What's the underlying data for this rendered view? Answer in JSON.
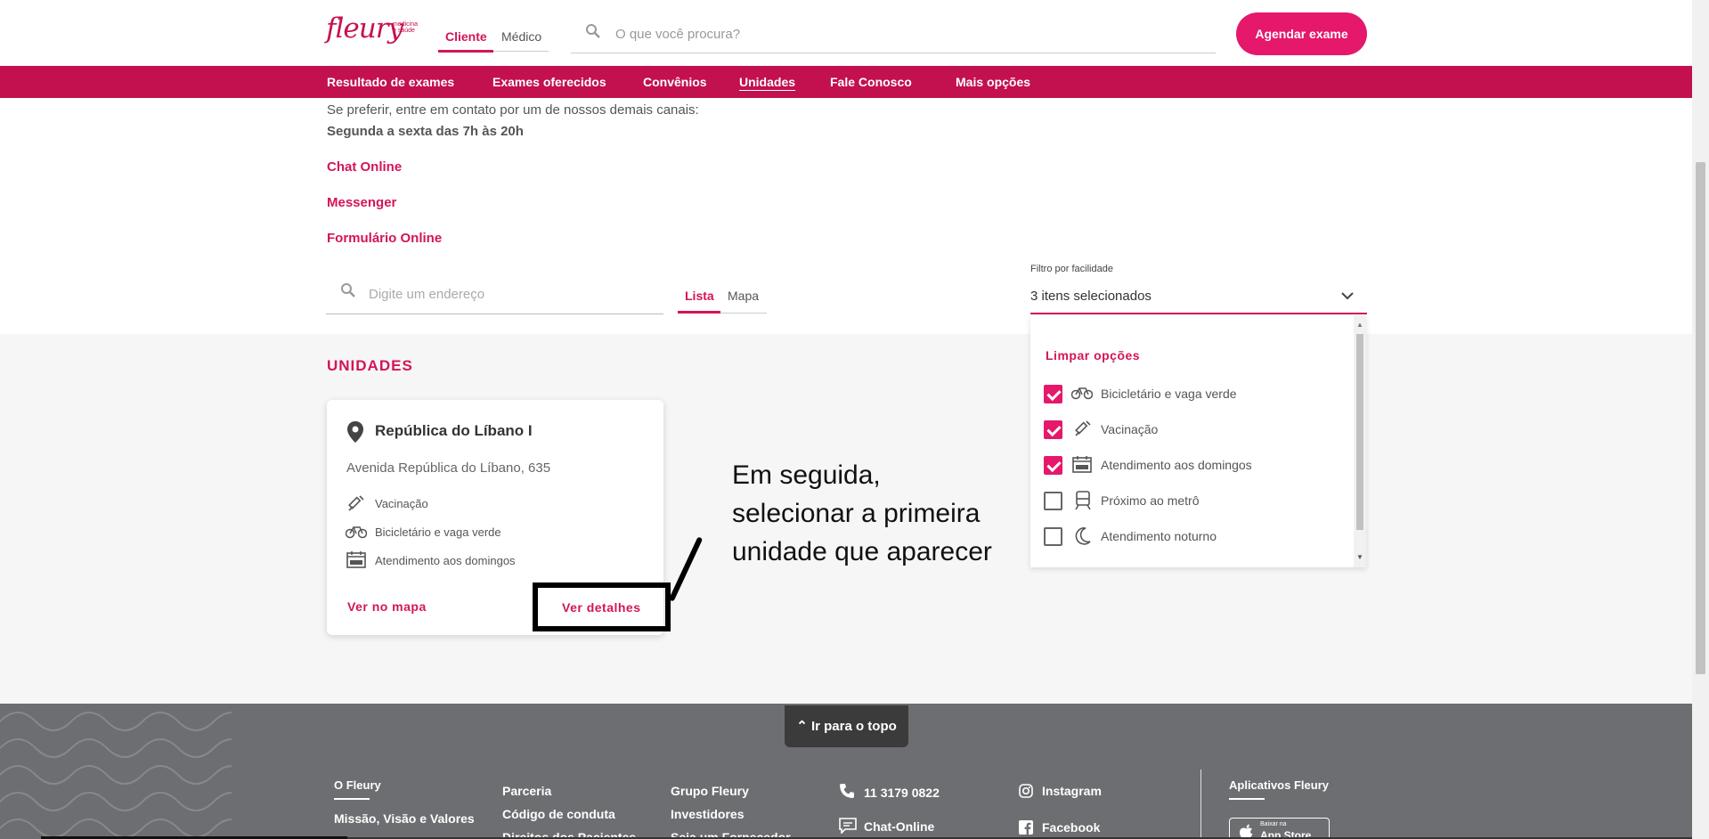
{
  "header": {
    "logo": "fleury",
    "logo_sub_1": "medicina",
    "logo_sub_2": "e saúde",
    "tabs": [
      "Cliente",
      "Médico"
    ],
    "search_placeholder": "O que você procura?",
    "cta": "Agendar exame"
  },
  "nav": [
    "Resultado de exames",
    "Exames oferecidos",
    "Convênios",
    "Unidades",
    "Fale Conosco",
    "Mais opções"
  ],
  "contact": {
    "intro": "Se preferir, entre em contato por um de nossos demais canais:",
    "hours": "Segunda a sexta das 7h às 20h",
    "links": [
      "Chat Online",
      "Messenger",
      "Formulário Online"
    ]
  },
  "search": {
    "address_placeholder": "Digite um endereço",
    "views": [
      "Lista",
      "Mapa"
    ]
  },
  "filter": {
    "label": "Filtro por facilidade",
    "value": "3 itens selecionados",
    "clear": "Limpar opções",
    "options": [
      {
        "label": "Bicicletário e vaga verde",
        "checked": true,
        "icon": "bicycle-icon"
      },
      {
        "label": "Vacinação",
        "checked": true,
        "icon": "syringe-icon"
      },
      {
        "label": "Atendimento aos domingos",
        "checked": true,
        "icon": "calendar-icon"
      },
      {
        "label": "Próximo ao metrô",
        "checked": false,
        "icon": "train-icon"
      },
      {
        "label": "Atendimento noturno",
        "checked": false,
        "icon": "moon-icon"
      }
    ]
  },
  "units": {
    "title": "UNIDADES",
    "card": {
      "name": "República do Líbano I",
      "address": "Avenida República do Líbano, 635",
      "features": [
        "Vacinação",
        "Bicicletário e vaga verde",
        "Atendimento aos domingos"
      ],
      "map_link": "Ver no mapa",
      "details_link": "Ver detalhes"
    }
  },
  "annotation": "Em seguida, selecionar a primeira unidade que aparecer",
  "footer": {
    "back_to_top": "Ir para o topo",
    "col1": [
      "O Fleury",
      "Missão, Visão e Valores"
    ],
    "col2": [
      "Parceria",
      "Código de conduta",
      "Direitos dos Pacientes"
    ],
    "col3": [
      "Grupo Fleury",
      "Investidores",
      "Seja um Fornecedor"
    ],
    "phone": "11 3179 0822",
    "chat": "Chat-Online",
    "social": [
      "Instagram",
      "Facebook"
    ],
    "apps_title": "Aplicativos Fleury",
    "store_small": "Baixar na",
    "store_big": "App Store"
  },
  "colors": {
    "brand": "#c3104f",
    "accent": "#e5186b",
    "footer": "#6d6e71"
  }
}
